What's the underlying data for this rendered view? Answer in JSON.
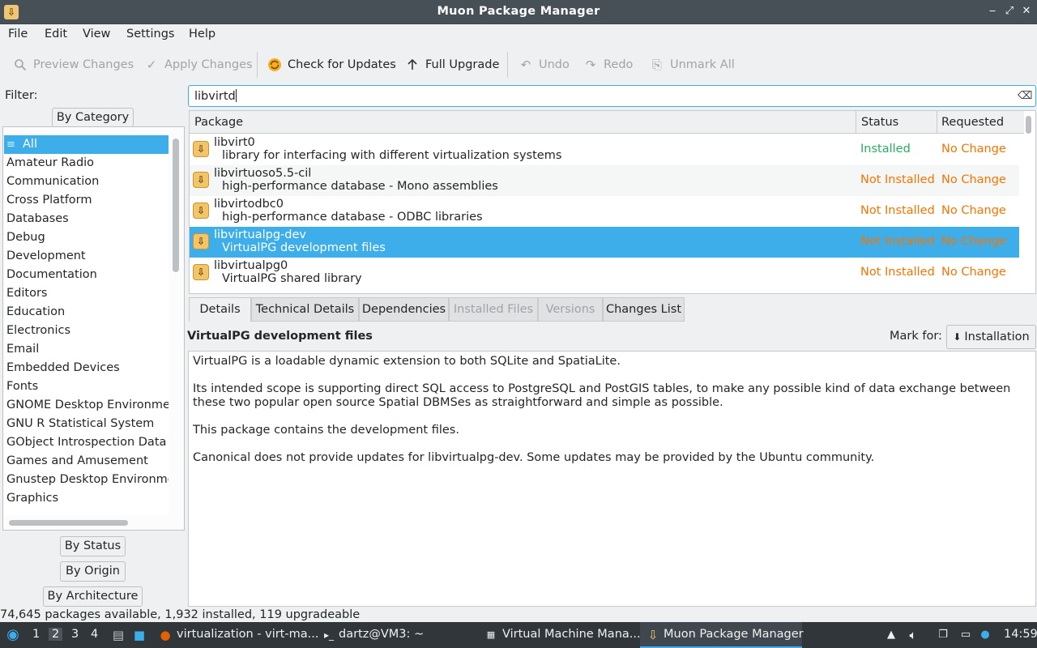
{
  "window": {
    "title": "Muon Package Manager"
  },
  "menu": [
    "File",
    "Edit",
    "View",
    "Settings",
    "Help"
  ],
  "toolbar": {
    "preview": "Preview Changes",
    "apply": "Apply Changes",
    "check": "Check for Updates",
    "upgrade": "Full Upgrade",
    "undo": "Undo",
    "redo": "Redo",
    "unmark": "Unmark All"
  },
  "filter": {
    "label": "Filter:",
    "by_category": "By Category",
    "by_status": "By Status",
    "by_origin": "By Origin",
    "by_architecture": "By Architecture",
    "categories": [
      "All",
      "Amateur Radio",
      "Communication",
      "Cross Platform",
      "Databases",
      "Debug",
      "Development",
      "Documentation",
      "Editors",
      "Education",
      "Electronics",
      "Email",
      "Embedded Devices",
      "Fonts",
      "GNOME Desktop Environment",
      "GNU R Statistical System",
      "GObject Introspection Data",
      "Games and Amusement",
      "Gnustep Desktop Environment",
      "Graphics"
    ]
  },
  "search": {
    "value": "libvirtd"
  },
  "table": {
    "headers": {
      "package": "Package",
      "status": "Status",
      "requested": "Requested"
    },
    "rows": [
      {
        "name": "libvirt0",
        "desc": "library for interfacing with different virtualization systems",
        "status": "Installed",
        "requested": "No Change"
      },
      {
        "name": "libvirtuoso5.5-cil",
        "desc": "high-performance database - Mono assemblies",
        "status": "Not Installed",
        "requested": "No Change"
      },
      {
        "name": "libvirtodbc0",
        "desc": "high-performance database - ODBC libraries",
        "status": "Not Installed",
        "requested": "No Change"
      },
      {
        "name": "libvirtualpg-dev",
        "desc": "VirtualPG development files",
        "status": "Not Installed",
        "requested": "No Change"
      },
      {
        "name": "libvirtualpg0",
        "desc": "VirtualPG shared library",
        "status": "Not Installed",
        "requested": "No Change"
      }
    ]
  },
  "tabs": [
    "Details",
    "Technical Details",
    "Dependencies",
    "Installed Files",
    "Versions",
    "Changes List"
  ],
  "details": {
    "title": "VirtualPG development files",
    "mark_for": "Mark for:",
    "install_button": "Installation",
    "p1": "VirtualPG is a loadable dynamic extension to both SQLite and SpatiaLite.",
    "p2": "Its intended scope is supporting direct SQL access to PostgreSQL and PostGIS tables, to make any possible kind of data exchange between these two popular open source Spatial DBMSes as straightforward and simple as possible.",
    "p3": "This package contains the development files.",
    "p4": "Canonical does not provide updates for libvirtualpg-dev. Some updates may be provided by the Ubuntu community."
  },
  "statusbar": "74,645 packages available, 1,932 installed, 119 upgradeable",
  "taskbar": {
    "desktops": [
      "1",
      "2",
      "3",
      "4"
    ],
    "tasks": [
      "virtualization - virt-ma...",
      "dartz@VM3: ~",
      "Virtual Machine Mana...",
      "Muon Package Manager"
    ],
    "clock": "14:59"
  },
  "colors": {
    "accent": "#3daee9",
    "installed": "#27ae60",
    "not_installed": "#f67400"
  }
}
